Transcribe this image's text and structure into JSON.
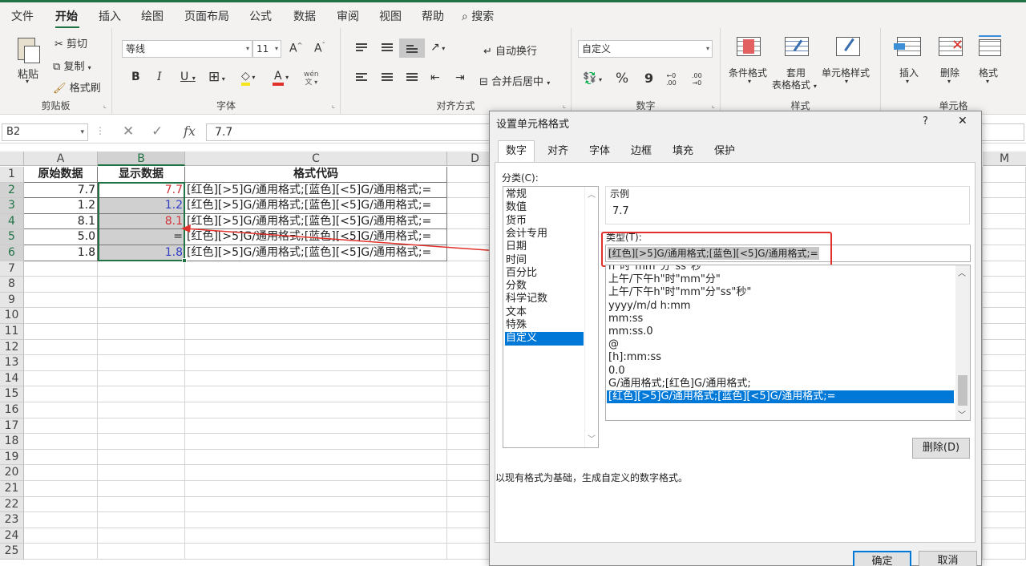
{
  "menu": {
    "items": [
      "文件",
      "开始",
      "插入",
      "绘图",
      "页面布局",
      "公式",
      "数据",
      "审阅",
      "视图",
      "帮助"
    ],
    "search": "搜索"
  },
  "ribbon": {
    "clipboard": {
      "paste": "粘贴",
      "cut": "剪切",
      "copy": "复制",
      "format_painter": "格式刷",
      "label": "剪贴板"
    },
    "font": {
      "name": "等线",
      "size": "11",
      "label": "字体",
      "bold": "B",
      "italic": "I",
      "underline": "U",
      "grow": "A",
      "shrink": "A",
      "phonetic": "wén"
    },
    "alignment": {
      "wrap": "自动换行",
      "merge": "合并后居中",
      "label": "对齐方式"
    },
    "number": {
      "format": "自定义",
      "label": "数字",
      "percent": "%",
      "comma": "9",
      "inc_decimal": ".00",
      "dec_decimal": ".00"
    },
    "styles": {
      "conditional": "条件格式",
      "table_line1": "套用",
      "table_line2": "表格格式",
      "cell_styles": "单元格样式",
      "label": "样式"
    },
    "cells": {
      "insert": "插入",
      "delete": "删除",
      "format": "格式",
      "label": "单元格"
    }
  },
  "formula_bar": {
    "name_box": "B2",
    "fx": "fx",
    "value": "7.7"
  },
  "sheet": {
    "columns": [
      "A",
      "B",
      "C",
      "D",
      "M"
    ],
    "rows": [
      "1",
      "2",
      "3",
      "4",
      "5",
      "6",
      "7",
      "8",
      "9",
      "10",
      "11",
      "12",
      "13",
      "14",
      "15",
      "16",
      "17",
      "18",
      "19",
      "20",
      "21",
      "22",
      "23",
      "24",
      "25"
    ],
    "headers": {
      "a": "原始数据",
      "b": "显示数据",
      "c": "格式代码"
    },
    "data": [
      {
        "a": "7.7",
        "b": "7.7",
        "b_color": "#d13438",
        "c": "[红色][>5]G/通用格式;[蓝色][<5]G/通用格式;="
      },
      {
        "a": "1.2",
        "b": "1.2",
        "b_color": "#2e3cc4",
        "c": "[红色][>5]G/通用格式;[蓝色][<5]G/通用格式;="
      },
      {
        "a": "8.1",
        "b": "8.1",
        "b_color": "#d13438",
        "c": "[红色][>5]G/通用格式;[蓝色][<5]G/通用格式;="
      },
      {
        "a": "5.0",
        "b": "=",
        "b_color": "#222222",
        "c": "[红色][>5]G/通用格式;[蓝色][<5]G/通用格式;="
      },
      {
        "a": "1.8",
        "b": "1.8",
        "b_color": "#2e3cc4",
        "c": "[红色][>5]G/通用格式;[蓝色][<5]G/通用格式;="
      }
    ]
  },
  "dialog": {
    "title": "设置单元格格式",
    "help": "?",
    "close": "✕",
    "tabs": [
      "数字",
      "对齐",
      "字体",
      "边框",
      "填充",
      "保护"
    ],
    "category_label": "分类(C):",
    "categories": [
      "常规",
      "数值",
      "货币",
      "会计专用",
      "日期",
      "时间",
      "百分比",
      "分数",
      "科学记数",
      "文本",
      "特殊",
      "自定义"
    ],
    "sample_label": "示例",
    "sample_value": "7.7",
    "type_label": "类型(T):",
    "type_value": "[红色][>5]G/通用格式;[蓝色][<5]G/通用格式;=",
    "type_list": [
      "h\"时\"mm\"分\"ss\"秒\"",
      "上午/下午h\"时\"mm\"分\"",
      "上午/下午h\"时\"mm\"分\"ss\"秒\"",
      "yyyy/m/d h:mm",
      "mm:ss",
      "mm:ss.0",
      "@",
      "[h]:mm:ss",
      "0.0",
      "G/通用格式;[红色]G/通用格式;",
      "[红色][>5]G/通用格式;[蓝色][<5]G/通用格式;="
    ],
    "delete_button": "删除(D)",
    "description": "以现有格式为基础，生成自定义的数字格式。",
    "ok": "确定",
    "cancel": "取消"
  },
  "colors": {
    "accent": "#217346",
    "selection": "#0078d7",
    "annotation": "#e0312b"
  }
}
